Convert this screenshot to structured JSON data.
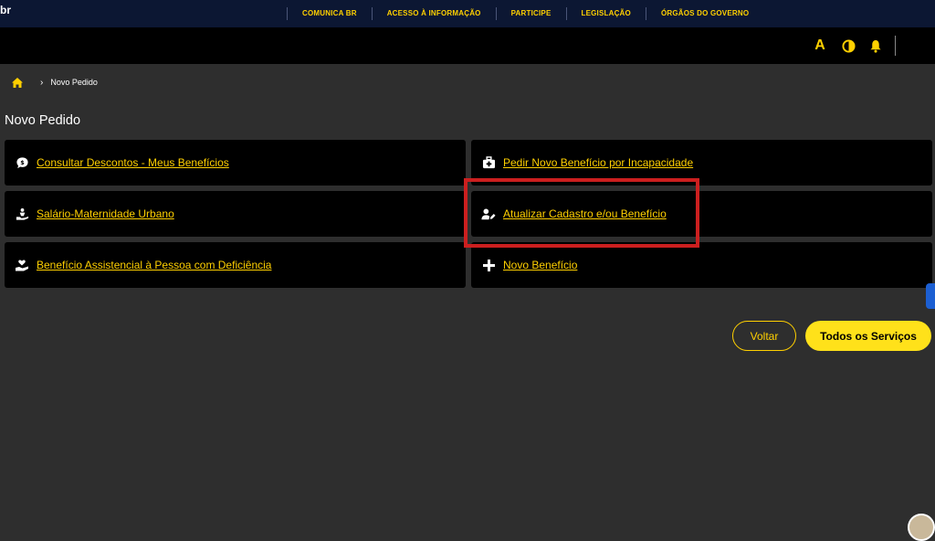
{
  "govbar": {
    "brand": "br",
    "links": [
      "COMUNICA BR",
      "ACESSO À INFORMAÇÃO",
      "PARTICIPE",
      "LEGISLAÇÃO",
      "ÓRGÃOS DO GOVERNO"
    ]
  },
  "header": {
    "font_tool": "A"
  },
  "breadcrumb": {
    "current": "Novo Pedido"
  },
  "page": {
    "title": "Novo Pedido"
  },
  "cards": [
    {
      "label": "Consultar Descontos - Meus Benefícios",
      "icon": "money-chat-icon"
    },
    {
      "label": "Pedir Novo Benefício por Incapacidade",
      "icon": "medkit-icon"
    },
    {
      "label": "Salário-Maternidade Urbano",
      "icon": "baby-hand-icon"
    },
    {
      "label": "Atualizar Cadastro e/ou Benefício",
      "icon": "user-edit-icon"
    },
    {
      "label": "Benefício Assistencial à Pessoa com Deficiência",
      "icon": "hand-heart-icon"
    },
    {
      "label": "Novo Benefício",
      "icon": "plus-icon"
    }
  ],
  "buttons": {
    "back": "Voltar",
    "all_services": "Todos os Serviços"
  },
  "colors": {
    "accent": "#ffd000",
    "background": "#2e2e2e",
    "card": "#000000",
    "govbar": "#0c1733",
    "highlight": "#cc1f1f"
  }
}
